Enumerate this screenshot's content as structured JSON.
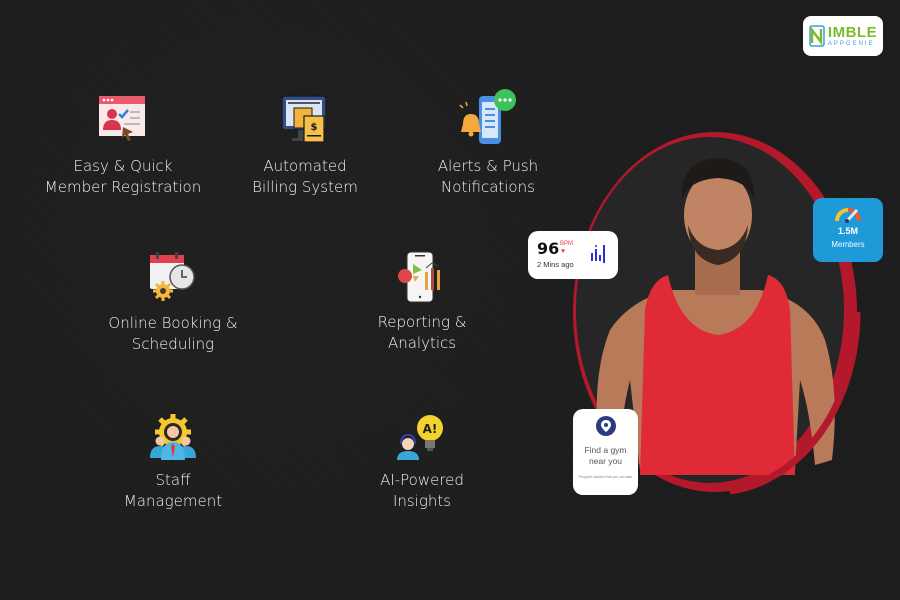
{
  "brand": {
    "logo_main": "IMBLE",
    "logo_sub": "APPGENIE",
    "logo_letter": "N",
    "colors": {
      "green": "#7dbb2e",
      "blue": "#37a3d8"
    }
  },
  "features": [
    {
      "id": "registration",
      "icon": "member-registration-icon",
      "line1": "Easy & Quick",
      "line2": "Member Registration"
    },
    {
      "id": "billing",
      "icon": "billing-receipt-icon",
      "line1": "Automated",
      "line2": "Billing System"
    },
    {
      "id": "alerts",
      "icon": "notification-bell-icon",
      "line1": "Alerts & Push",
      "line2": "Notifications"
    },
    {
      "id": "booking",
      "icon": "calendar-clock-icon",
      "line1": "Online Booking &",
      "line2": "Scheduling"
    },
    {
      "id": "reporting",
      "icon": "analytics-phone-icon",
      "line1": "Reporting &",
      "line2": "Analytics"
    },
    {
      "id": "staff",
      "icon": "staff-gear-icon",
      "line1": "Staff",
      "line2": "Management"
    },
    {
      "id": "ai",
      "icon": "ai-lightbulb-icon",
      "line1": "AI-Powered",
      "line2": "Insights"
    }
  ],
  "hero": {
    "accent_color": "#b3182b",
    "heart_rate_card": {
      "value": "96",
      "unit": "BPM",
      "heart": "♥",
      "time": "2 Mins ago"
    },
    "members_card": {
      "value": "1.5M",
      "label": "Members",
      "color": "#1e9ad9"
    },
    "gym_card": {
      "title_line1": "Find a gym",
      "title_line2": "near you",
      "subtitle": "Program classes that you can take"
    }
  }
}
